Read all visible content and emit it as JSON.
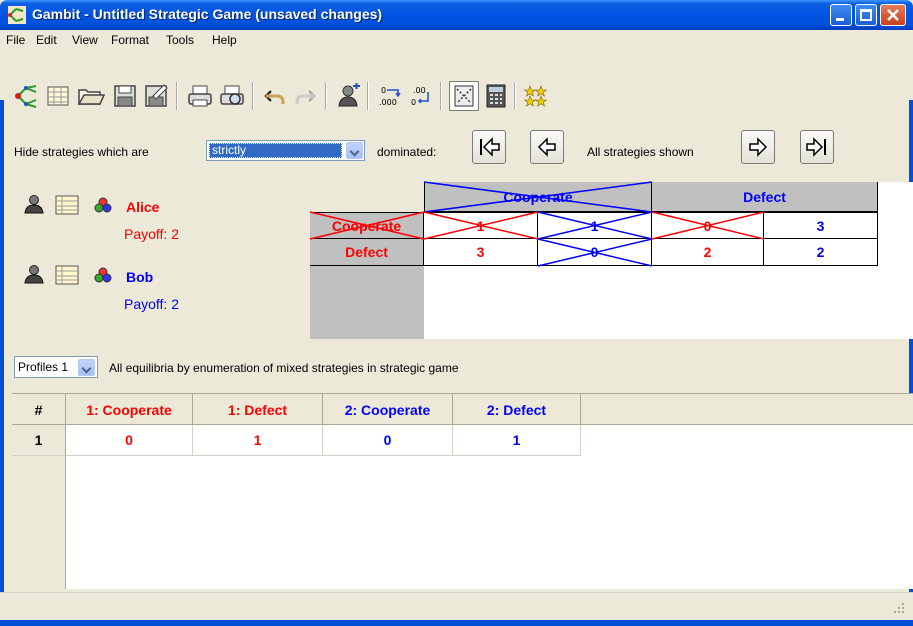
{
  "window": {
    "title": "Gambit - Untitled Strategic Game (unsaved changes)"
  },
  "menu": [
    "File",
    "Edit",
    "View",
    "Format",
    "Tools",
    "Help"
  ],
  "toolbar": {
    "icons": [
      "gambit-tree-icon",
      "new-table-icon",
      "open-folder-icon",
      "save-icon",
      "save-as-icon",
      "print-icon",
      "print-preview-icon",
      "undo-icon",
      "redo-icon",
      "add-player-icon",
      "decimals-add-icon",
      "decimals-remove-icon",
      "dominance-icon",
      "calculator-icon",
      "equilibria-icon"
    ]
  },
  "dominance": {
    "hide_label": "Hide strategies which are",
    "selected": "strictly",
    "dominated_label": "dominated:",
    "status": "All strategies shown"
  },
  "players": [
    {
      "name": "Alice",
      "payoff": "Payoff: 2",
      "color": "#ff0000"
    },
    {
      "name": "Bob",
      "payoff": "Payoff: 2",
      "color": "#0000ff"
    }
  ],
  "game": {
    "col_strategies": [
      "Cooperate",
      "Defect"
    ],
    "row_strategies": [
      "Cooperate",
      "Defect"
    ],
    "payoffs": [
      [
        [
          "1",
          "1"
        ],
        [
          "0",
          "3"
        ]
      ],
      [
        [
          "3",
          "0"
        ],
        [
          "2",
          "2"
        ]
      ]
    ]
  },
  "profiles": {
    "selector": "Profiles 1",
    "description": "All equilibria by enumeration of mixed strategies in strategic game",
    "columns": [
      "#",
      "1: Cooperate",
      "1: Defect",
      "2: Cooperate",
      "2: Defect"
    ],
    "rows": [
      [
        "1",
        "0",
        "1",
        "0",
        "1"
      ]
    ]
  },
  "colors": {
    "player1": "#ff0000",
    "player2": "#0000ff",
    "titlebar": "#0054e3"
  }
}
